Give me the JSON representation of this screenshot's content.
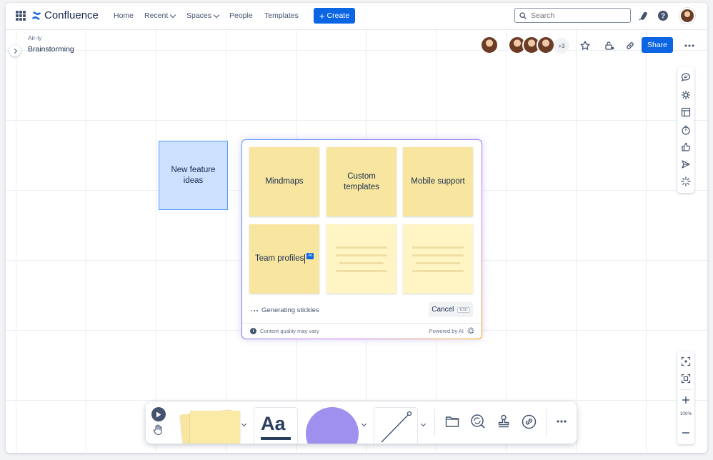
{
  "topnav": {
    "brand": "Confluence",
    "items": [
      {
        "label": "Home"
      },
      {
        "label": "Recent"
      },
      {
        "label": "Spaces"
      },
      {
        "label": "People"
      },
      {
        "label": "Templates"
      }
    ],
    "create_label": "Create",
    "search_placeholder": "Search"
  },
  "header": {
    "breadcrumb": "Air-ly",
    "title": "Brainstorming",
    "collaborators_more": "+3",
    "share_label": "Share"
  },
  "whiteboard": {
    "blue_sticky": "New feature ideas",
    "ai_panel": {
      "stickies": [
        "Mindmaps",
        "Custom templates",
        "Mobile support",
        "Team profiles"
      ],
      "ai_badge": "AI",
      "status": "Generating stickies",
      "cancel_label": "Cancel",
      "cancel_shortcut": "ESC",
      "disclaimer": "Content quality may vary",
      "powered_by": "Powered by AI"
    },
    "zoom_level": "100%"
  },
  "toolbar": {
    "text_tool_label": "Aa"
  },
  "colors": {
    "primary": "#0c66e4",
    "sticky_yellow": "#f8e6a0",
    "sticky_blue": "#cce0ff",
    "shape_purple": "#9f8fef"
  },
  "icons": [
    "app-switcher-icon",
    "confluence-logo-icon",
    "search-icon",
    "notifications-icon",
    "help-icon",
    "star-icon",
    "restrictions-icon",
    "link-icon",
    "more-icon",
    "comment-icon",
    "loops-icon",
    "table-icon",
    "timer-icon",
    "vote-icon",
    "send-icon",
    "ai-sparkle-icon",
    "fit-to-screen-icon",
    "focus-icon",
    "zoom-in-icon",
    "zoom-out-icon",
    "play-icon",
    "hand-icon",
    "folder-icon",
    "search-replace-icon",
    "stamp-icon",
    "link-tool-icon"
  ]
}
